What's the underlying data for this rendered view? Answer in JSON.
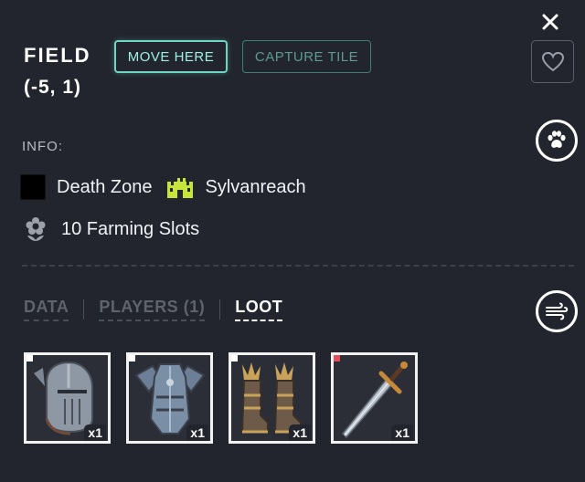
{
  "tile": {
    "name": "FIELD",
    "coords": "(-5, 1)"
  },
  "actions": {
    "move_label": "MOVE HERE",
    "capture_label": "CAPTURE TILE"
  },
  "icons": {
    "close": "close-icon",
    "favorite": "heart-icon",
    "paw": "paw-icon",
    "wind": "wind-icon",
    "castle": "castle-icon",
    "flower": "flower-icon"
  },
  "info": {
    "label": "INFO:",
    "zone": "Death Zone",
    "realm": "Sylvanreach",
    "farming": "10 Farming Slots"
  },
  "tabs": [
    {
      "label": "DATA",
      "active": false
    },
    {
      "label": "PLAYERS (1)",
      "active": false
    },
    {
      "label": "LOOT",
      "active": true
    }
  ],
  "loot": [
    {
      "name": "helmet",
      "qty": "x1",
      "rarity_color": "#ffffff"
    },
    {
      "name": "chest-armor",
      "qty": "x1",
      "rarity_color": "#ffffff"
    },
    {
      "name": "boots",
      "qty": "x1",
      "rarity_color": "#ffffff"
    },
    {
      "name": "sword",
      "qty": "x1",
      "rarity_color": "#e34b5f"
    }
  ],
  "colors": {
    "background": "#22252d",
    "accent": "#6fd6c4",
    "realm_icon": "#c6e43a"
  }
}
